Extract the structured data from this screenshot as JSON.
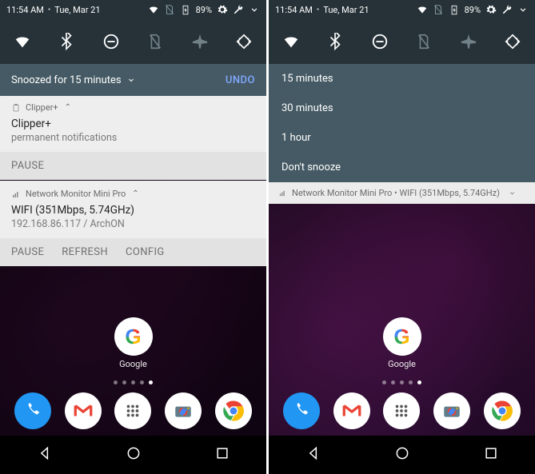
{
  "status": {
    "time": "11:54 AM",
    "date": "Tue, Mar 21",
    "battery_pct": "89%"
  },
  "snooze": {
    "label": "Snoozed for 15 minutes",
    "undo": "UNDO",
    "options": [
      "15 minutes",
      "30 minutes",
      "1 hour",
      "Don't snooze"
    ]
  },
  "clipper": {
    "app": "Clipper+",
    "title": "Clipper+",
    "subtitle": "permanent notifications",
    "actions": [
      "PAUSE"
    ]
  },
  "netmon": {
    "app": "Network Monitor Mini Pro",
    "title": "WIFI  (351Mbps, 5.74GHz)",
    "subtitle": "192.168.86.117 / ArchON",
    "actions": [
      "PAUSE",
      "REFRESH",
      "CONFIG"
    ],
    "collapsed": "Network Monitor Mini Pro • WIFI  (351Mbps, 5.74GHz)"
  },
  "google_label": "Google"
}
